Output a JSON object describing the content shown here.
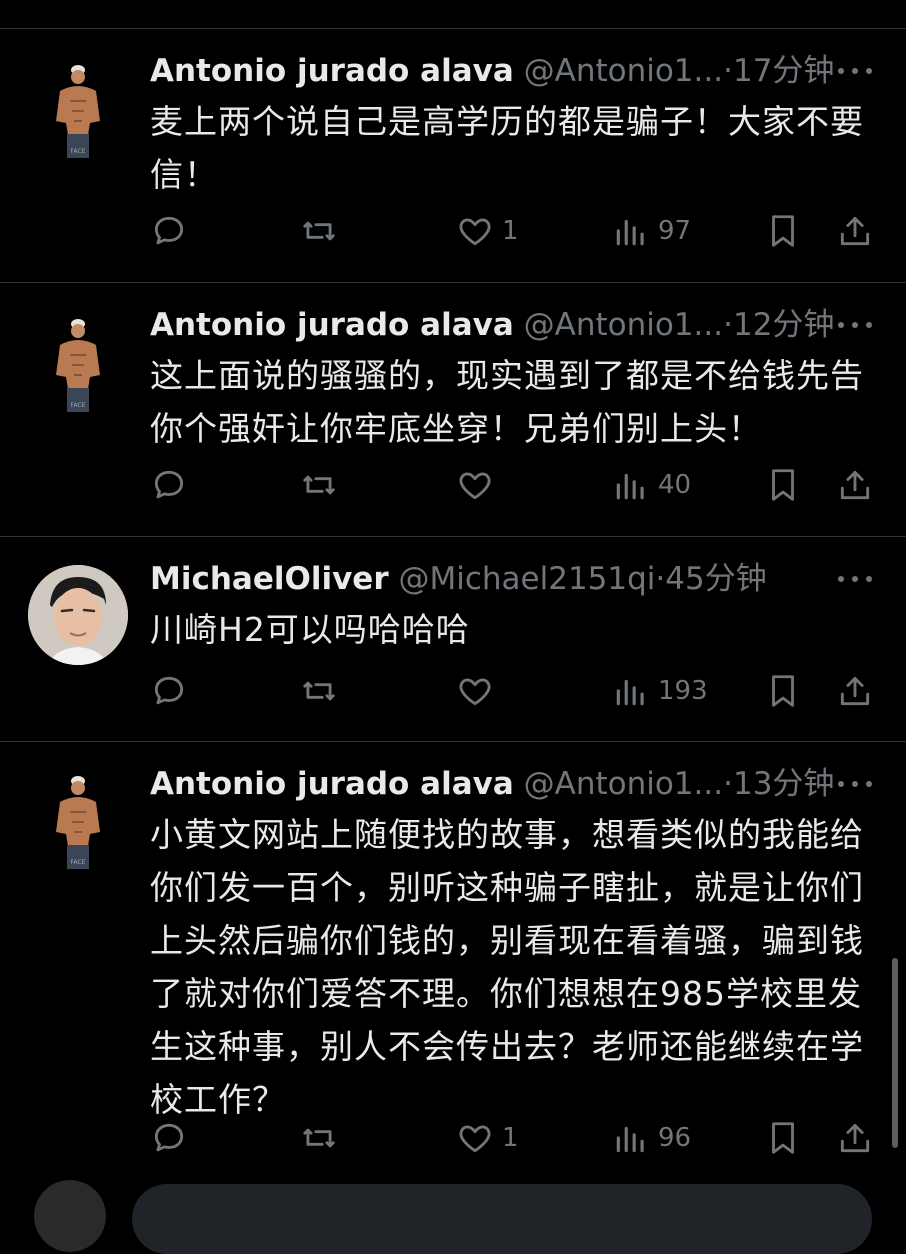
{
  "tweets": [
    {
      "name": "Antonio jurado alava",
      "handle": "@Antonio1...",
      "separator": "·",
      "time": "17分钟",
      "text": "麦上两个说自己是高学历的都是骗子！大家不要信！",
      "likes": "1",
      "views": "97",
      "avatar": "shirtless-man-avatar"
    },
    {
      "name": "Antonio jurado alava",
      "handle": "@Antonio1...",
      "separator": "·",
      "time": "12分钟",
      "text": "这上面说的骚骚的，现实遇到了都是不给钱先告你个强奸让你牢底坐穿！兄弟们别上头！",
      "likes": "",
      "views": "40",
      "avatar": "shirtless-man-avatar"
    },
    {
      "name": "MichaelOliver",
      "handle": "@Michael2151qi",
      "separator": "·",
      "time": "45分钟",
      "text": "川崎H2可以吗哈哈哈",
      "likes": "",
      "views": "193",
      "avatar": "man-portrait-avatar"
    },
    {
      "name": "Antonio jurado alava",
      "handle": "@Antonio1...",
      "separator": "·",
      "time": "13分钟",
      "text": "小黄文网站上随便找的故事，想看类似的我能给你们发一百个，别听这种骗子瞎扯，就是让你们上头然后骗你们钱的，别看现在看着骚，骗到钱了就对你们爱答不理。你们想想在985学校里发生这种事，别人不会传出去？老师还能继续在学校工作？",
      "likes": "1",
      "views": "96",
      "avatar": "shirtless-man-avatar"
    }
  ],
  "icons": {
    "reply": "reply-icon",
    "retweet": "retweet-icon",
    "like": "heart-icon",
    "views": "views-chart-icon",
    "bookmark": "bookmark-icon",
    "share": "share-icon",
    "more": "more-icon"
  },
  "colors": {
    "background": "#000000",
    "text": "#e7e9ea",
    "muted": "#71767b",
    "divider": "#2f3336"
  }
}
